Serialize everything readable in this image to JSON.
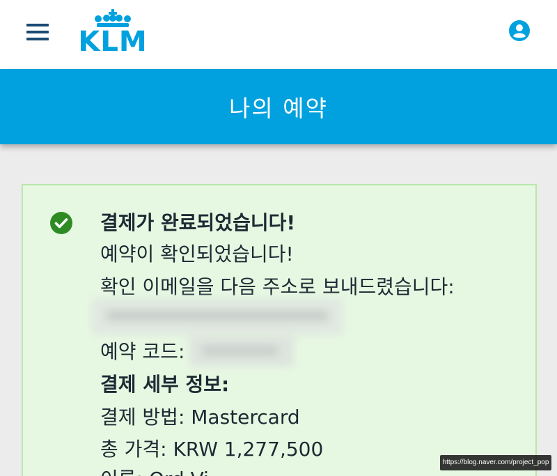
{
  "header": {
    "logo_text": "KLM",
    "menu_icon": "hamburger-menu-icon",
    "account_icon": "user-account-icon",
    "brand_color": "#00a1de"
  },
  "banner": {
    "title": "나의 예약"
  },
  "confirmation": {
    "status_icon": "check-circle-icon",
    "status_color": "#2e8b24",
    "heading": "결제가 완료되었습니다!",
    "booking_confirmed": "예약이 확인되었습니다!",
    "email_sent": "확인 이메일을 다음 주소로 보내드렸습니다:",
    "booking_code_label": "예약 코드:",
    "payment_details_heading": "결제 세부 정보:",
    "payment_method": "결제 방법: Mastercard",
    "total_price": "총 가격: KRW 1,277,500",
    "cut_off_line": "이름: Ord Vi"
  },
  "watermark": {
    "text": "https://blog.naver.com/project_pop"
  }
}
